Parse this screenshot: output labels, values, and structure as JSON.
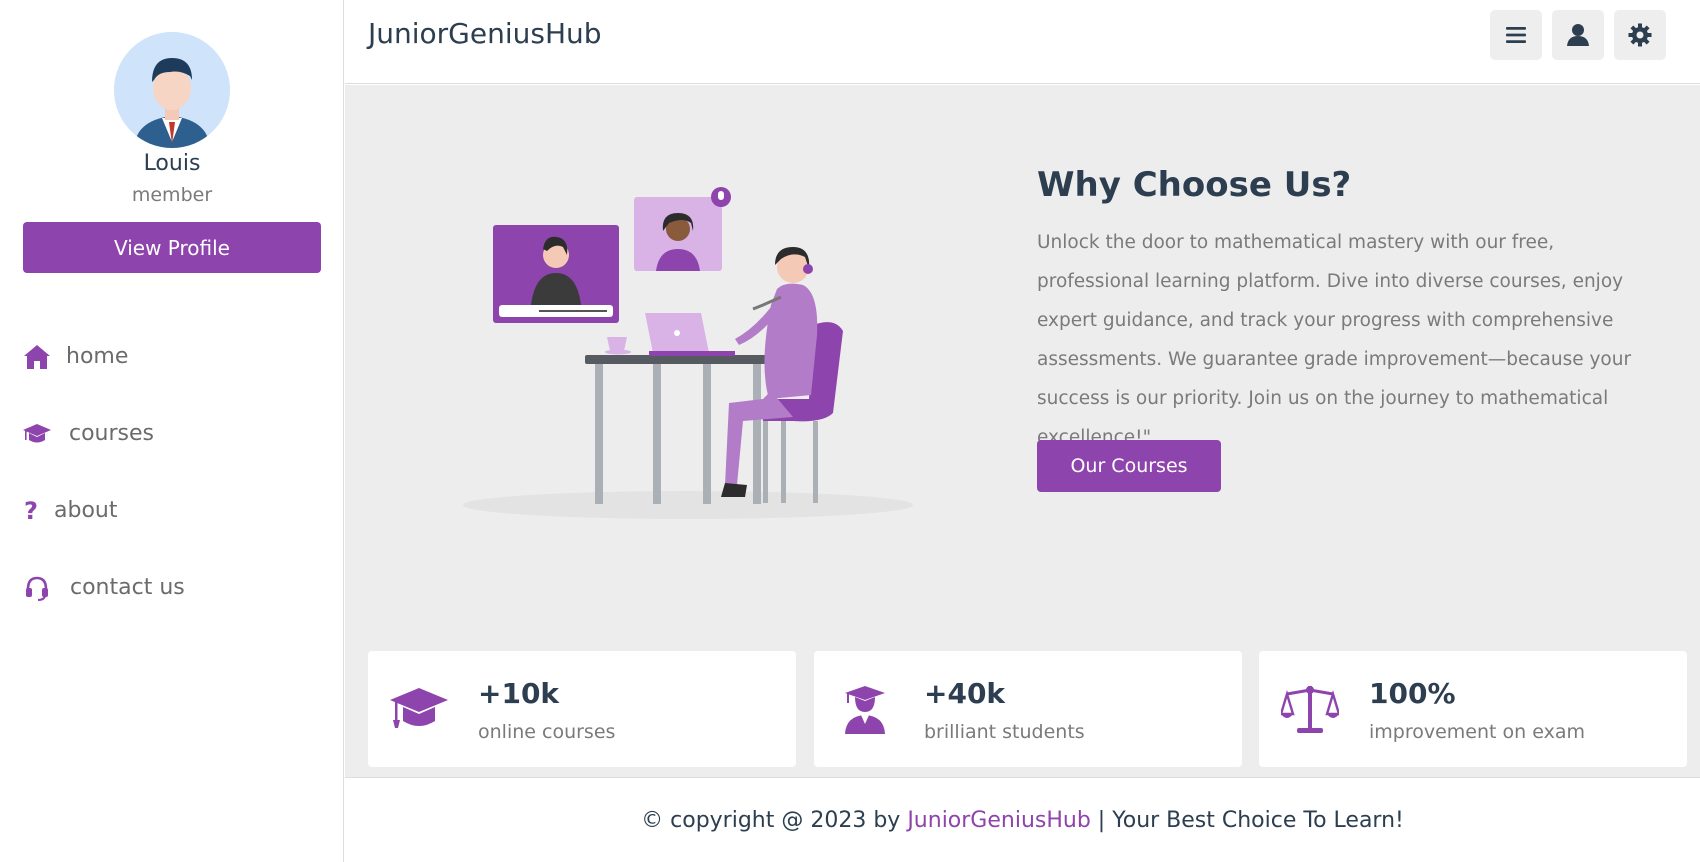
{
  "app": {
    "title": "JuniorGeniusHub"
  },
  "colors": {
    "accent": "#8e44ad",
    "text_dark": "#2c3e50",
    "text_muted": "#7a7a7a",
    "main_bg": "#ededed"
  },
  "header": {
    "logo": "JuniorGeniusHub",
    "buttons": [
      {
        "icon": "menu-icon"
      },
      {
        "icon": "user-icon"
      },
      {
        "icon": "gear-icon"
      }
    ]
  },
  "sidebar": {
    "user": {
      "name": "Louis",
      "role": "member"
    },
    "view_profile_label": "View Profile",
    "items": [
      {
        "label": "home",
        "icon": "home-icon"
      },
      {
        "label": "courses",
        "icon": "graduation-cap-icon"
      },
      {
        "label": "about",
        "icon": "question-icon"
      },
      {
        "label": "contact us",
        "icon": "headset-icon"
      }
    ]
  },
  "main": {
    "about": {
      "title": "Why Choose Us?",
      "text": "Unlock the door to mathematical mastery with our free, professional learning platform. Dive into diverse courses, enjoy expert guidance, and track your progress with comprehensive assessments. We guarantee grade improvement—because your success is our priority. Join us on the journey to mathematical excellence!\"",
      "button_label": "Our Courses"
    },
    "stats": [
      {
        "value": "+10k",
        "label": "online courses",
        "icon": "graduation-cap-icon"
      },
      {
        "value": "+40k",
        "label": "brilliant students",
        "icon": "graduate-user-icon"
      },
      {
        "value": "100%",
        "label": "improvement on exam",
        "icon": "scale-icon"
      }
    ]
  },
  "footer": {
    "prefix": "© copyright @ 2023 by ",
    "brand": "JuniorGeniusHub",
    "suffix": " | Your Best Choice To Learn!"
  }
}
